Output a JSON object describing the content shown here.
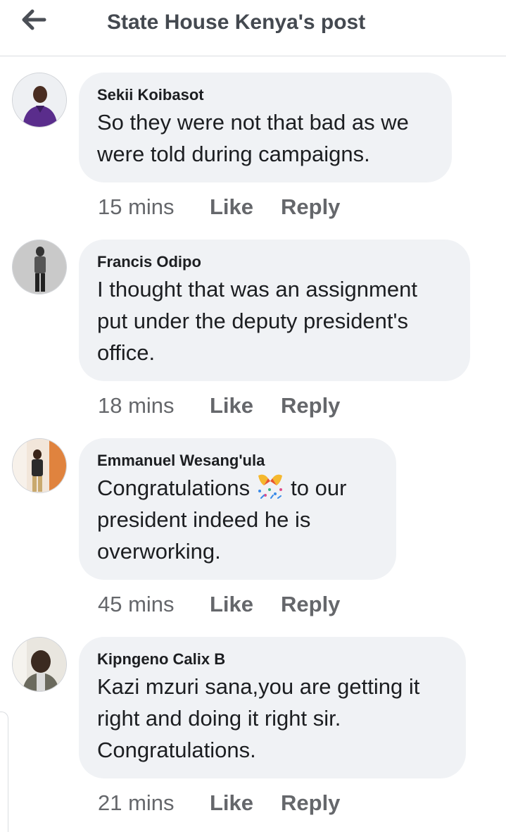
{
  "header": {
    "title": "State House Kenya's post",
    "back_icon": "arrow-left-icon"
  },
  "comments": [
    {
      "author": "Sekii Koibasot",
      "lines": [
        "So they were not that bad as we",
        "were told during campaigns."
      ],
      "time": "15 mins",
      "like_label": "Like",
      "reply_label": "Reply"
    },
    {
      "author": "Francis Odipo",
      "lines": [
        "I thought that was an assignment",
        "put under the deputy president's",
        "office."
      ],
      "time": "18 mins",
      "like_label": "Like",
      "reply_label": "Reply"
    },
    {
      "author": "Emmanuel Wesang'ula",
      "line1_before": "Congratulations",
      "line1_after": "to our",
      "emoji": "party-popper-icon",
      "lines_rest": [
        "president  indeed he is",
        "overworking."
      ],
      "time": "45 mins",
      "like_label": "Like",
      "reply_label": "Reply"
    },
    {
      "author": "Kipngeno Calix B",
      "lines": [
        "Kazi mzuri sana,you are getting it",
        "right and doing it right sir.",
        "Congratulations."
      ],
      "time": "21 mins",
      "like_label": "Like",
      "reply_label": "Reply"
    }
  ],
  "colors": {
    "bubble": "#f0f2f5",
    "text": "#1c1e21",
    "meta": "#65676b",
    "header_title": "#444950"
  }
}
